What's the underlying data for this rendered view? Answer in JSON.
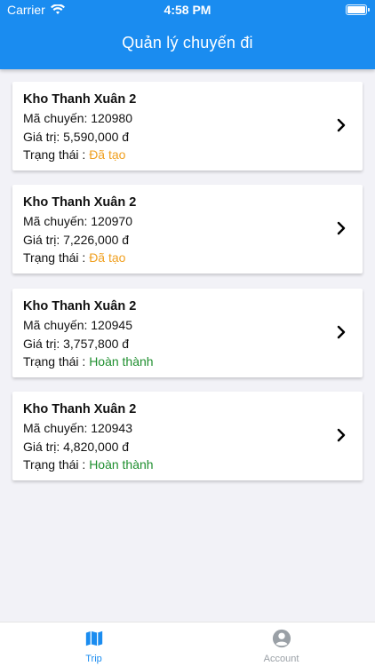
{
  "status_bar": {
    "carrier": "Carrier",
    "time": "4:58 PM"
  },
  "header": {
    "title": "Quản lý chuyến đi"
  },
  "trips": [
    {
      "warehouse": "Kho Thanh Xuân 2",
      "code_label": "Mã chuyến:",
      "code": "120980",
      "value_label": "Giá trị:",
      "value": "5,590,000 đ",
      "status_label": "Trạng thái :",
      "status": "Đã tạo"
    },
    {
      "warehouse": "Kho Thanh Xuân 2",
      "code_label": "Mã chuyến:",
      "code": "120970",
      "value_label": "Giá trị:",
      "value": "7,226,000 đ",
      "status_label": "Trạng thái :",
      "status": "Đã tạo"
    },
    {
      "warehouse": "Kho Thanh Xuân 2",
      "code_label": "Mã chuyến:",
      "code": "120945",
      "value_label": "Giá trị:",
      "value": "3,757,800 đ",
      "status_label": "Trạng thái :",
      "status": "Hoàn thành"
    },
    {
      "warehouse": "Kho Thanh Xuân 2",
      "code_label": "Mã chuyến:",
      "code": "120943",
      "value_label": "Giá trị:",
      "value": "4,820,000 đ",
      "status_label": "Trạng thái :",
      "status": "Hoàn thành"
    }
  ],
  "tabs": {
    "trip": {
      "label": "Trip"
    },
    "account": {
      "label": "Account"
    }
  },
  "colors": {
    "header": "#1a8cf0",
    "status_created": "#f0a020",
    "status_done": "#1f8f2f",
    "tab_active": "#1a8cf0",
    "tab_inactive": "#9aa0a6"
  }
}
